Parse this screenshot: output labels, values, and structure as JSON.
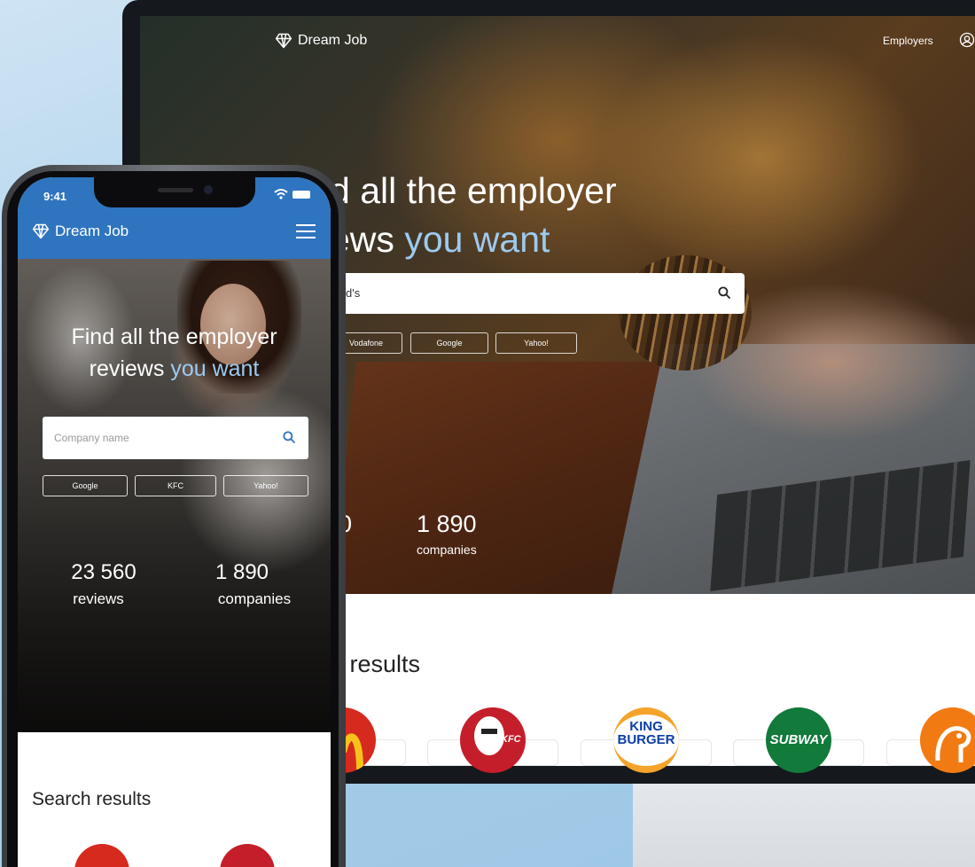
{
  "brand": "Dream Job",
  "desktop": {
    "nav": {
      "employers": "Employers"
    },
    "hero": {
      "title_line1": "d all the employer",
      "title_line2_plain": "ews ",
      "title_line2_accent": "you want",
      "search_value": "d's",
      "chips": [
        "Vodafone",
        "Google",
        "Yahoo!"
      ],
      "stats": [
        {
          "number": "0",
          "label": ""
        },
        {
          "number": "1 890",
          "label": "companies"
        }
      ]
    },
    "results": {
      "title": "h results",
      "logos": [
        {
          "name": "McDonald's",
          "text": "",
          "color": "#d62a1f"
        },
        {
          "name": "KFC",
          "text": "KFC",
          "color": "#c41e2a"
        },
        {
          "name": "Burger King",
          "text": "KING BURGER",
          "color": "#f4a42a"
        },
        {
          "name": "Subway",
          "text": "SUBWAY",
          "color": "#127a3a"
        },
        {
          "name": "Bird logo",
          "text": "",
          "color": "#f27a12"
        }
      ]
    }
  },
  "phone": {
    "status": {
      "time": "9:41"
    },
    "hero": {
      "title_line1": "Find all the employer",
      "title_line2_plain": "reviews ",
      "title_line2_accent": "you want",
      "search_placeholder": "Company name",
      "chips": [
        "Google",
        "KFC",
        "Yahoo!"
      ],
      "stats": [
        {
          "number": "23 560",
          "label": "reviews"
        },
        {
          "number": "1 890",
          "label": "companies"
        }
      ]
    },
    "results": {
      "title": "Search results"
    }
  },
  "colors": {
    "brand_blue": "#2f74bf",
    "accent_light_blue": "#9ccaf0",
    "background": "#a9cfe9"
  },
  "icons": [
    "diamond-logo-icon",
    "user-icon",
    "search-icon",
    "menu-icon",
    "wifi-icon",
    "battery-icon"
  ]
}
